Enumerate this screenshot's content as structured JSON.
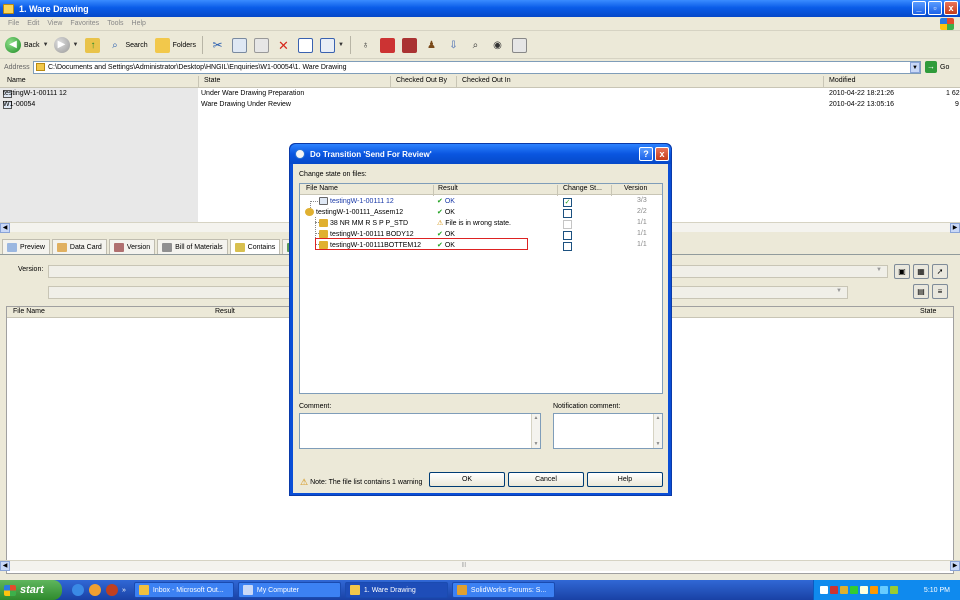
{
  "window": {
    "title": "1. Ware Drawing",
    "minimize": "_",
    "maximize": "▫",
    "close": "x"
  },
  "menu": [
    "File",
    "Edit",
    "View",
    "Favorites",
    "Tools",
    "Help"
  ],
  "toolbar": {
    "back": "Back",
    "search": "Search",
    "folders": "Folders"
  },
  "address": {
    "label": "Address",
    "value": "C:\\Documents and Settings\\Administrator\\Desktop\\HNGIL\\Enquiries\\W1-00054\\1. Ware Drawing",
    "go": "Go"
  },
  "filelist": {
    "columns": [
      "Name",
      "State",
      "Checked Out By",
      "Checked Out In",
      "Modified"
    ],
    "rows": [
      {
        "name": "testingW-1-00111 12",
        "state": "Under Ware Drawing Preparation",
        "modified": "2010-04-22 18:21:26",
        "extra": "1 62"
      },
      {
        "name": "W1-00054",
        "state": "Ware Drawing Under Review",
        "modified": "2010-04-22 13:05:16",
        "extra": "9"
      }
    ]
  },
  "tabs": [
    "Preview",
    "Data Card",
    "Version",
    "Bill of Materials",
    "Contains"
  ],
  "lower": {
    "version_label": "Version:",
    "columns": [
      "File Name",
      "Result",
      "State"
    ]
  },
  "dialog": {
    "title": "Do Transition 'Send For Review'",
    "help": "?",
    "close": "x",
    "heading": "Change state on files:",
    "columns": [
      "File Name",
      "Result",
      "Change St...",
      "Version"
    ],
    "rows": [
      {
        "name": "testingW-1-00111 12",
        "result": "OK",
        "checked": true,
        "version": "3/3"
      },
      {
        "name": "testingW-1-00111_Assem12",
        "result": "OK",
        "checked": false,
        "version": "2/2"
      },
      {
        "name": "38 NR MM R S P P_STD",
        "result": "File is in wrong state.",
        "checked": false,
        "version": "1/1"
      },
      {
        "name": "testingW-1-00111 BODY12",
        "result": "OK",
        "checked": false,
        "version": "1/1"
      },
      {
        "name": "testingW-1-00111BOTTEM12",
        "result": "OK",
        "checked": false,
        "version": "1/1"
      }
    ],
    "comment_label": "Comment:",
    "notification_label": "Notification comment:",
    "note": "Note: The file list contains 1 warning",
    "ok": "OK",
    "cancel": "Cancel",
    "help_button": "Help"
  },
  "taskbar": {
    "start": "start",
    "tasks": [
      "Inbox - Microsoft Out...",
      "My Computer",
      "1. Ware Drawing",
      "SolidWorks Forums: S..."
    ],
    "clock": "5:10 PM"
  },
  "icons": {
    "ok_mark": "✔",
    "warning_mark": "⚠",
    "checkbox_mark": "✓"
  }
}
